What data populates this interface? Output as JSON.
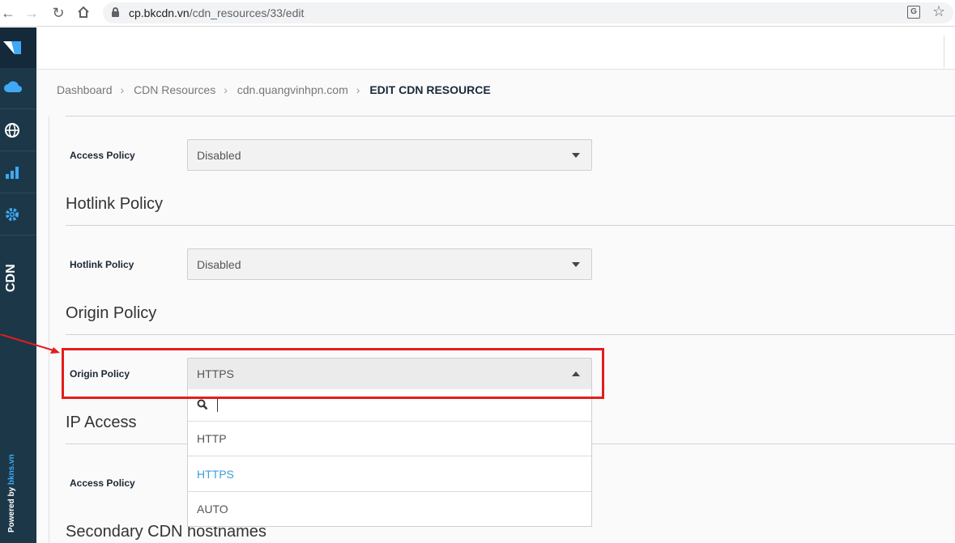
{
  "browser": {
    "url_host": "cp.bkcdn.vn",
    "url_path": "/cdn_resources/33/edit"
  },
  "sidebar": {
    "vertical_label": "CDN",
    "powered_prefix": "Powered by ",
    "powered_brand": "bkns.vn",
    "items": [
      {
        "icon": "cloud-icon"
      },
      {
        "icon": "globe-icon"
      },
      {
        "icon": "bar-chart-icon"
      },
      {
        "icon": "gear-icon"
      }
    ]
  },
  "breadcrumb": {
    "items": [
      "Dashboard",
      "CDN Resources",
      "cdn.quangvinhpn.com"
    ],
    "current": "EDIT CDN RESOURCE"
  },
  "form": {
    "access_policy_label": "Access Policy",
    "access_policy_value": "Disabled",
    "hotlink_section": "Hotlink Policy",
    "hotlink_label": "Hotlink Policy",
    "hotlink_value": "Disabled",
    "origin_section": "Origin Policy",
    "origin_label": "Origin Policy",
    "origin_value": "HTTPS",
    "ip_access_section": "IP Access",
    "ip_access_label": "Access Policy",
    "secondary_section": "Secondary CDN hostnames"
  },
  "dropdown": {
    "options": [
      "HTTP",
      "HTTPS",
      "AUTO"
    ],
    "selected": "HTTPS"
  },
  "colors": {
    "sidebar": "#1c3848",
    "accent": "#3a9fd9",
    "highlight": "#e31d1d"
  }
}
